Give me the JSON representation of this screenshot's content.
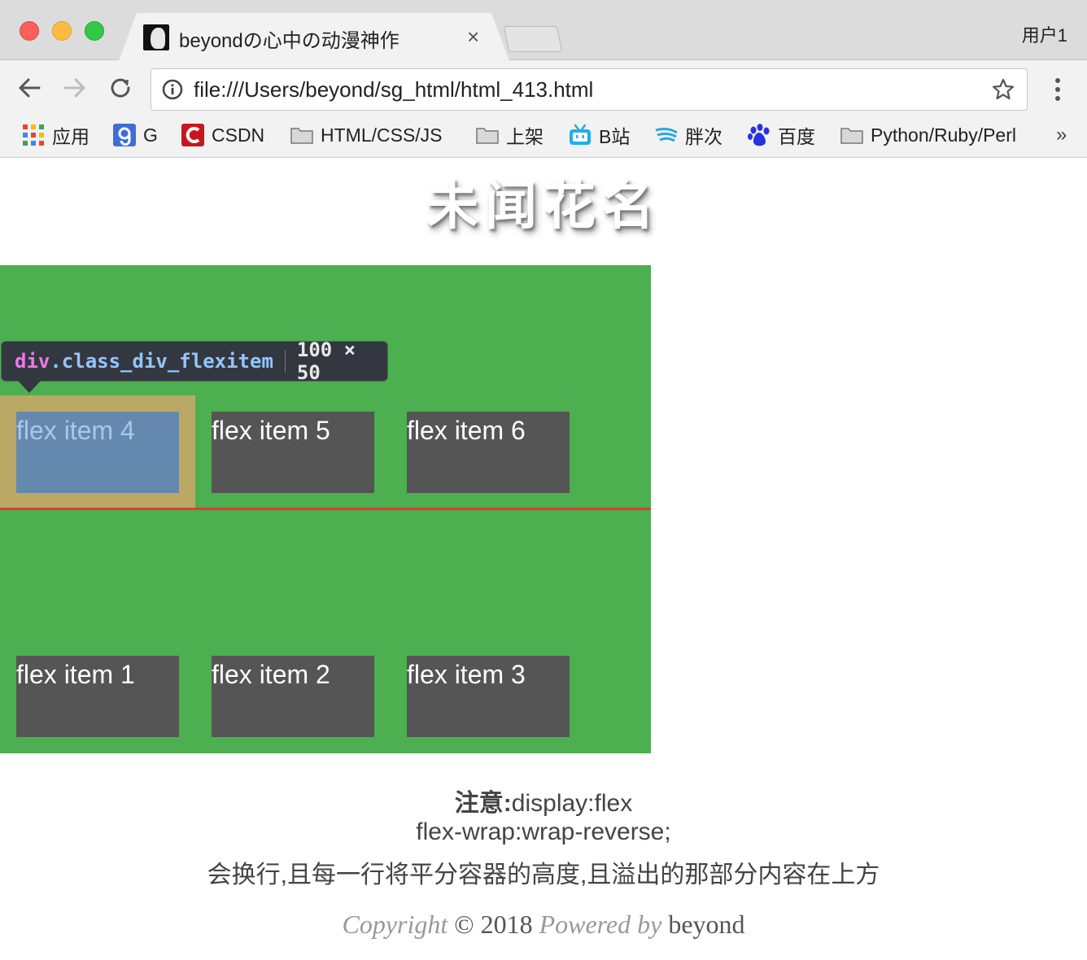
{
  "browser": {
    "tab_title": "beyondの心中の动漫神作",
    "tab_close": "×",
    "profile_label": "用户1",
    "url": "file:///Users/beyond/sg_html/html_413.html",
    "more_bookmarks": "»",
    "bookmarks": [
      {
        "label": "应用",
        "icon": "apps-grid-icon"
      },
      {
        "label": "G",
        "icon": "g-site-icon"
      },
      {
        "label": "CSDN",
        "icon": "csdn-icon"
      },
      {
        "label": "HTML/CSS/JS",
        "icon": "folder-icon"
      },
      {
        "label": "上架",
        "icon": "folder-icon"
      },
      {
        "label": "B站",
        "icon": "bilibili-icon"
      },
      {
        "label": "胖次",
        "icon": "wing-icon"
      },
      {
        "label": "百度",
        "icon": "baidu-paw-icon"
      },
      {
        "label": "Python/Ruby/Perl",
        "icon": "folder-icon"
      }
    ]
  },
  "page": {
    "title": "未闻花名",
    "tooltip": {
      "tag": "div",
      "class_name": ".class_div_flexitem",
      "dimensions": "100 × 50"
    },
    "flex_items": {
      "item1": "flex item 1",
      "item2": "flex item 2",
      "item3": "flex item 3",
      "item4": "flex item 4",
      "item5": "flex item 5",
      "item6": "flex item 6"
    },
    "note": {
      "label": "注意:",
      "line1": "display:flex",
      "line2": "flex-wrap:wrap-reverse;",
      "line3": "会换行,且每一行将平分容器的高度,且溢出的那部分内容在上方"
    },
    "footer": {
      "copyright_word": "Copyright",
      "symbol_year": "© 2018",
      "powered_by": "Powered by",
      "author": "beyond"
    }
  },
  "colors": {
    "container": "#4caf50",
    "item": "#555555",
    "highlight_content": "#6589ae",
    "highlight_margin": "#b9a965",
    "line_divider": "#e53935",
    "tooltip_bg": "#333740"
  }
}
